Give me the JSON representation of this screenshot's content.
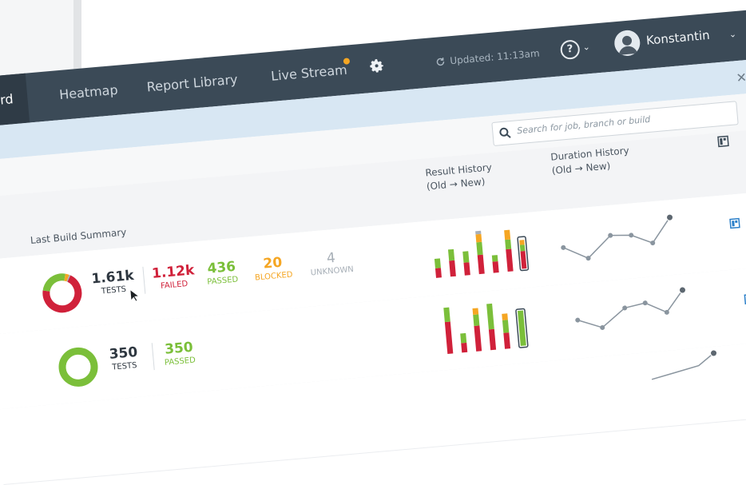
{
  "nav": {
    "tabs": [
      {
        "label": "oard",
        "active": true
      },
      {
        "label": "Heatmap"
      },
      {
        "label": "Report Library"
      },
      {
        "label": "Live Stream"
      }
    ],
    "updated": "Updated: 11:13am",
    "help": "?",
    "user": "Konstantin",
    "accent_color": "#f5a623"
  },
  "search": {
    "placeholder": "Search for job, branch or build"
  },
  "table": {
    "col_result": [
      "Result History",
      "(Old → New)"
    ],
    "col_duration": [
      "Duration History",
      "(Old → New)"
    ],
    "col_summary": "Last Build Summary"
  },
  "rows": [
    {
      "tests": "1.61k",
      "tests_label": "TESTS",
      "failed": "1.12k",
      "failed_label": "FAILED",
      "passed": "436",
      "passed_label": "PASSED",
      "blocked": "20",
      "blocked_label": "BLOCKED",
      "unknown": "4",
      "unknown_label": "UNKNOWN"
    },
    {
      "tests": "350",
      "tests_label": "TESTS",
      "passed": "350",
      "passed_label": "PASSED"
    }
  ],
  "colors": {
    "failed": "#d0213a",
    "passed": "#7bbf3a",
    "blocked": "#f5a623",
    "unknown": "#a7afb7"
  }
}
